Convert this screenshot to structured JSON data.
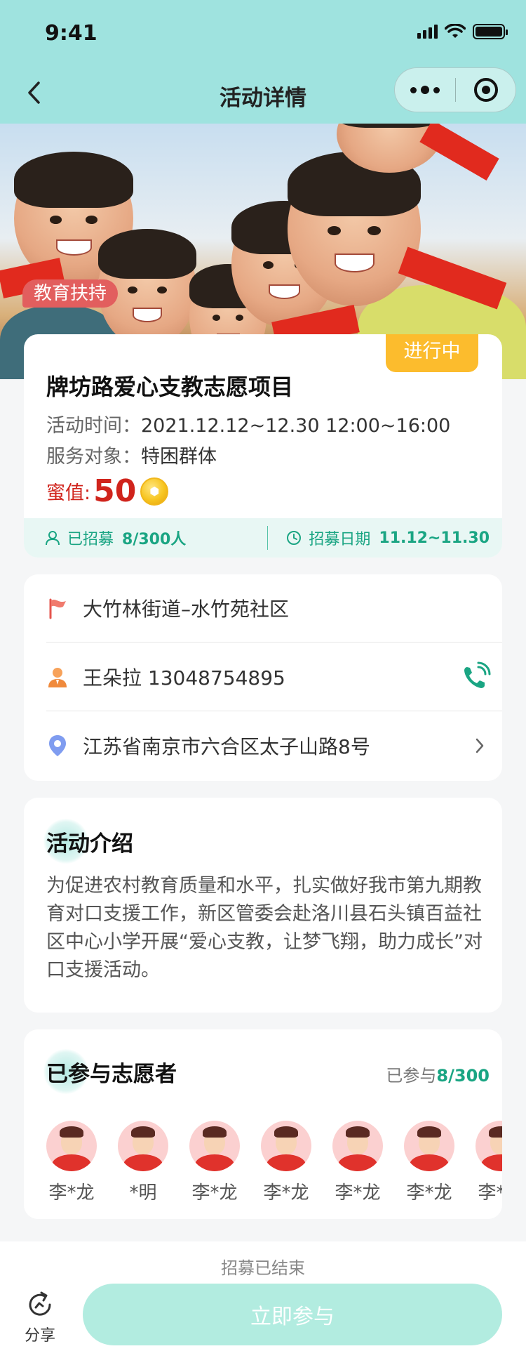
{
  "status_bar": {
    "time": "9:41"
  },
  "nav": {
    "title": "活动详情"
  },
  "hero": {
    "tag": "教育扶持"
  },
  "activity": {
    "status": "进行中",
    "title": "牌坊路爱心支教志愿项目",
    "time_label": "活动时间：",
    "time_value": "2021.12.12~12.30 12:00~16:00",
    "target_label": "服务对象：",
    "target_value": "特困群体",
    "honey_label": "蜜值:",
    "honey_value": "50",
    "recruited_label": "已招募",
    "recruited_value": "8/300人",
    "recruit_date_label": "招募日期",
    "recruit_date_value": "11.12~11.30"
  },
  "contact": {
    "community": "大竹林街道–水竹苑社区",
    "person": "王朵拉 13048754895",
    "address": "江苏省南京市六合区太子山路8号"
  },
  "intro": {
    "title": "活动介绍",
    "text": "为促进农村教育质量和水平，扎实做好我市第九期教育对口支援工作，新区管委会赴洛川县石头镇百益社区中心小学开展“爱心支教，让梦飞翔，助力成长”对口支援活动。"
  },
  "volunteers": {
    "title": "已参与志愿者",
    "count_label": "已参与",
    "count_joined": "8",
    "count_total": "/300",
    "list": [
      "李*龙",
      "*明",
      "李*龙",
      "李*龙",
      "李*龙",
      "李*龙",
      "李*龙"
    ]
  },
  "footer": {
    "note": "招募已结束",
    "share_label": "分享",
    "join_label": "立即参与"
  },
  "colors": {
    "header_bg": "#9fe3df",
    "accent_green": "#1aa583",
    "honey_red": "#d0241c",
    "status_yellow": "#fcbc2d",
    "tag_red": "#e25e5e",
    "join_btn_disabled": "#b2ece0"
  }
}
